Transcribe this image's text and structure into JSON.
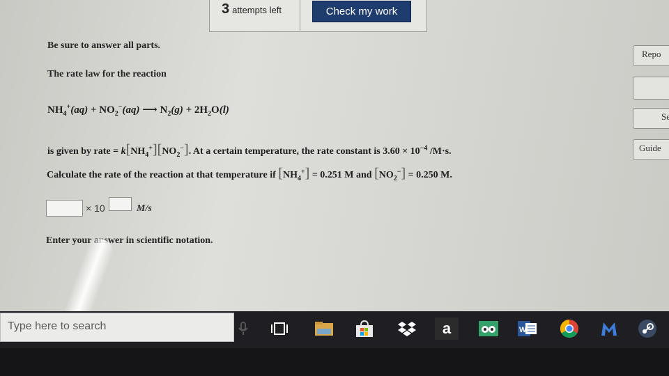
{
  "top": {
    "attempts_count": "3",
    "attempts_label": "attempts left",
    "check_button": "Check my work"
  },
  "side": {
    "report": "Repo",
    "blank": "",
    "s": "Se",
    "guide": "Guide"
  },
  "question": {
    "intro": "Be sure to answer all parts.",
    "rate_law_label": "The rate law for the reaction",
    "reaction": {
      "r1": "NH",
      "r1_sub": "4",
      "r1_sup": "+",
      "r1_state": "(aq)",
      "plus1": " + ",
      "r2": "NO",
      "r2_sub": "2",
      "r2_sup": "−",
      "r2_state": "(aq)",
      "arrow": " ⟶ ",
      "p1": "N",
      "p1_sub": "2",
      "p1_state": "(g)",
      "plus2": " + 2H",
      "p2_sub": "2",
      "p2": "O",
      "p2_state": "(l)"
    },
    "given_prefix": "is given by rate = ",
    "k": "k",
    "nh4": "NH",
    "nh4_sub": "4",
    "nh4_sup": "+",
    "no2": "NO",
    "no2_sub": "2",
    "no2_sup": "−",
    "given_suffix": ". At a certain temperature, the rate constant is 3.60 × 10",
    "exp": "−4",
    "units": " /M·s.",
    "calc_prefix": "Calculate the rate of the reaction at that temperature if ",
    "conc1": "= 0.251 M and ",
    "conc2": "= 0.250 M.",
    "times10": "× 10",
    "answer_units": "M/s",
    "answer_mantissa": "",
    "answer_exponent": "",
    "note": "Enter your answer in scientific notation."
  },
  "taskbar": {
    "search_placeholder": "Type here to search",
    "icons": [
      "microphone-icon",
      "task-view-icon",
      "file-explorer-icon",
      "store-icon",
      "dropbox-icon",
      "amazon-icon",
      "tripadvisor-icon",
      "word-icon",
      "chrome-icon",
      "malwarebytes-icon",
      "steam-icon"
    ],
    "amazon": "a",
    "word": "W"
  }
}
